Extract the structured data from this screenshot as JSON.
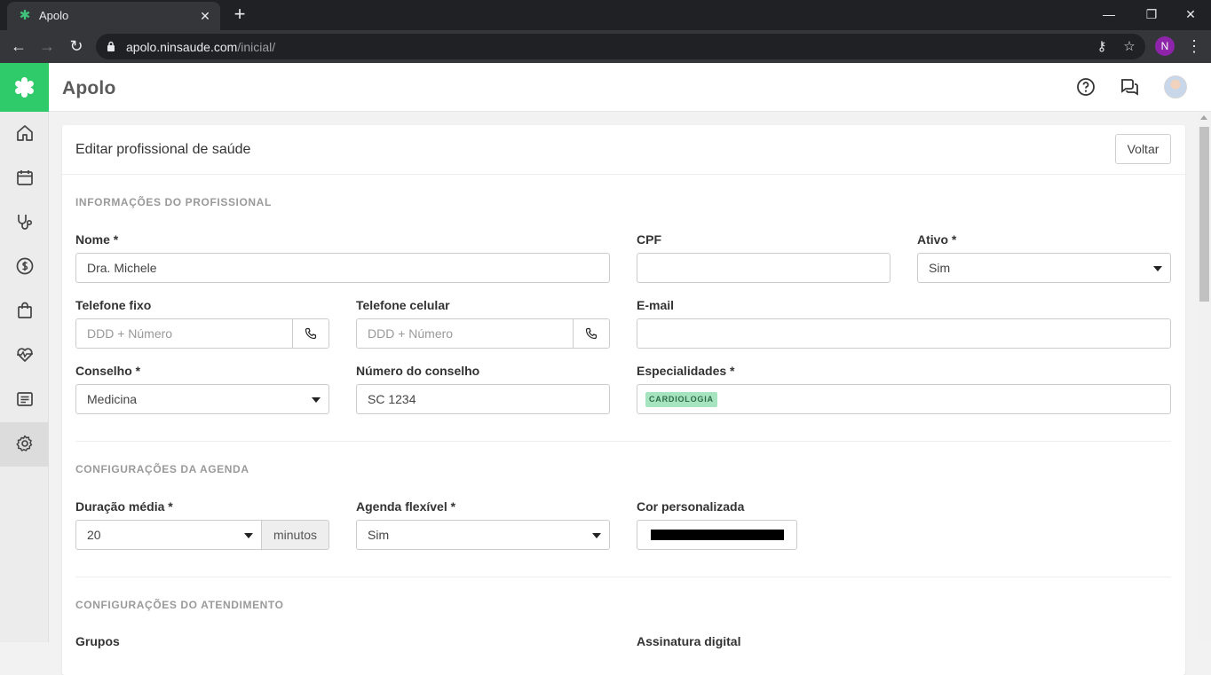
{
  "browser": {
    "tab_title": "Apolo",
    "tab_close": "✕",
    "new_tab": "+",
    "url_host": "apolo.ninsaude.com",
    "url_path": "/inicial/",
    "profile_initial": "N"
  },
  "app": {
    "title": "Apolo",
    "accent_color": "#2fca69"
  },
  "page": {
    "title": "Editar profissional de saúde",
    "back_button": "Voltar"
  },
  "section_professional": {
    "title": "INFORMAÇÕES DO PROFISSIONAL",
    "nome_label": "Nome *",
    "nome_value": "Dra. Michele",
    "cpf_label": "CPF",
    "cpf_value": "",
    "ativo_label": "Ativo *",
    "ativo_value": "Sim",
    "telefone_fixo_label": "Telefone fixo",
    "telefone_fixo_placeholder": "DDD + Número",
    "telefone_celular_label": "Telefone celular",
    "telefone_celular_placeholder": "DDD + Número",
    "email_label": "E-mail",
    "email_value": "",
    "conselho_label": "Conselho *",
    "conselho_value": "Medicina",
    "numero_conselho_label": "Número do conselho",
    "numero_conselho_value": "SC 1234",
    "especialidades_label": "Especialidades *",
    "especialidades_tags": [
      "CARDIOLOGIA"
    ]
  },
  "section_agenda": {
    "title": "CONFIGURAÇÕES DA AGENDA",
    "duracao_label": "Duração média *",
    "duracao_value": "20",
    "duracao_unit": "minutos",
    "agenda_flexivel_label": "Agenda flexível *",
    "agenda_flexivel_value": "Sim",
    "cor_label": "Cor personalizada",
    "cor_value": "#000000"
  },
  "section_atendimento": {
    "title": "CONFIGURAÇÕES DO ATENDIMENTO",
    "grupos_label": "Grupos",
    "assinatura_label": "Assinatura digital"
  },
  "sidebar": {
    "items": [
      "home-icon",
      "calendar-icon",
      "stethoscope-icon",
      "dollar-icon",
      "shopping-bag-icon",
      "heart-pulse-icon",
      "report-icon",
      "gear-icon"
    ],
    "active": "gear-icon"
  }
}
